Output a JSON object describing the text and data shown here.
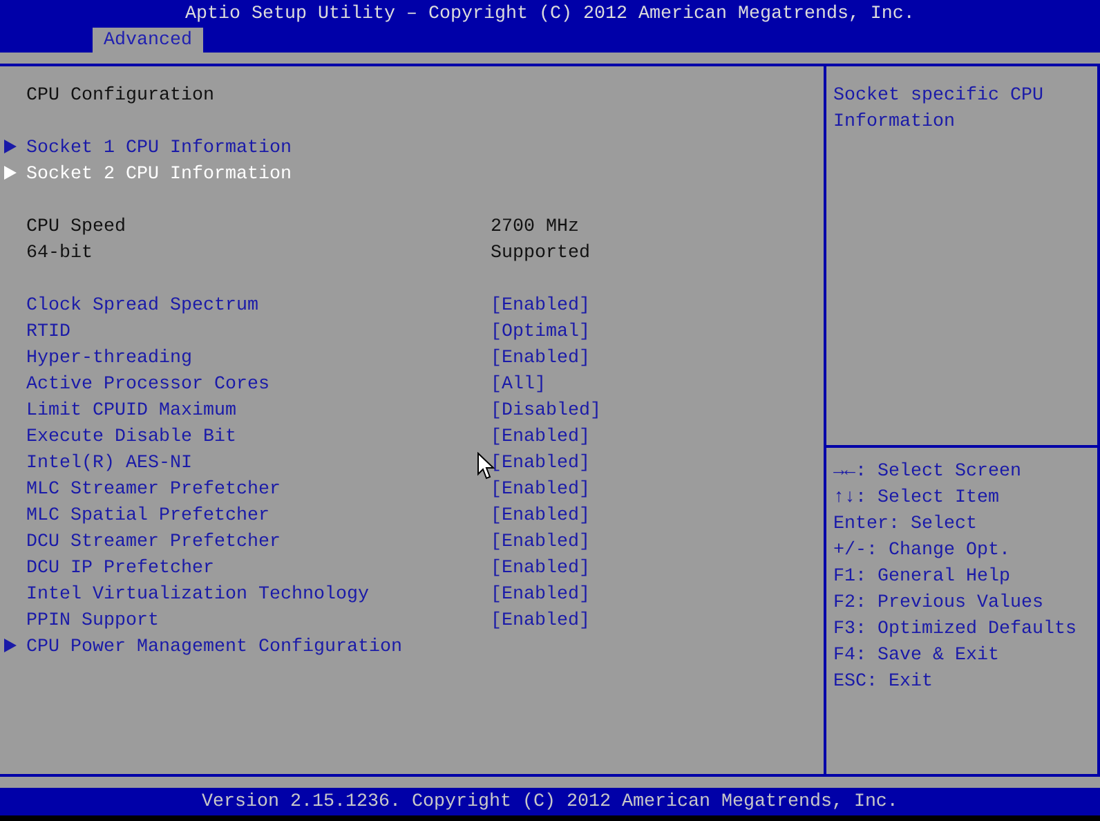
{
  "window": {
    "title": "Aptio Setup Utility – Copyright (C) 2012 American Megatrends, Inc."
  },
  "tabs": [
    {
      "label": "Advanced",
      "selected": true
    }
  ],
  "sections": [
    {
      "items": [
        {
          "kind": "heading",
          "label": "CPU Configuration"
        }
      ]
    },
    {
      "items": [
        {
          "kind": "submenu",
          "label": "Socket 1 CPU Information",
          "selected": false
        },
        {
          "kind": "submenu",
          "label": "Socket 2 CPU Information",
          "selected": true
        }
      ]
    },
    {
      "items": [
        {
          "kind": "info",
          "label": "CPU Speed",
          "value": "2700 MHz"
        },
        {
          "kind": "info",
          "label": "64-bit",
          "value": "Supported"
        }
      ]
    },
    {
      "items": [
        {
          "kind": "setting",
          "label": "Clock Spread Spectrum",
          "value": "[Enabled]",
          "selected": false
        },
        {
          "kind": "setting",
          "label": "RTID",
          "value": "[Optimal]",
          "selected": false
        },
        {
          "kind": "setting",
          "label": "Hyper-threading",
          "value": "[Enabled]",
          "selected": false
        },
        {
          "kind": "setting",
          "label": "Active Processor Cores",
          "value": "[All]",
          "selected": false
        },
        {
          "kind": "setting",
          "label": "Limit CPUID Maximum",
          "value": "[Disabled]",
          "selected": false
        },
        {
          "kind": "setting",
          "label": "Execute Disable Bit",
          "value": "[Enabled]",
          "selected": false
        },
        {
          "kind": "setting",
          "label": "Intel(R) AES-NI",
          "value": "[Enabled]",
          "selected": false
        },
        {
          "kind": "setting",
          "label": "MLC Streamer Prefetcher",
          "value": "[Enabled]",
          "selected": false
        },
        {
          "kind": "setting",
          "label": "MLC Spatial Prefetcher",
          "value": "[Enabled]",
          "selected": false
        },
        {
          "kind": "setting",
          "label": "DCU Streamer Prefetcher",
          "value": "[Enabled]",
          "selected": false
        },
        {
          "kind": "setting",
          "label": "DCU IP Prefetcher",
          "value": "[Enabled]",
          "selected": false
        },
        {
          "kind": "setting",
          "label": "Intel Virtualization Technology",
          "value": "[Enabled]",
          "selected": false
        },
        {
          "kind": "setting",
          "label": "PPIN Support",
          "value": "[Enabled]",
          "selected": false
        },
        {
          "kind": "submenu",
          "label": "CPU Power Management Configuration",
          "selected": false
        }
      ]
    }
  ],
  "help": {
    "description": "Socket specific CPU Information",
    "keys": [
      "→←: Select Screen",
      "↑↓: Select Item",
      "Enter: Select",
      "+/-: Change Opt.",
      "F1: General Help",
      "F2: Previous Values",
      "F3: Optimized Defaults",
      "F4: Save & Exit",
      "ESC: Exit"
    ]
  },
  "status_bar": "Version 2.15.1236. Copyright (C) 2012 American Megatrends, Inc."
}
